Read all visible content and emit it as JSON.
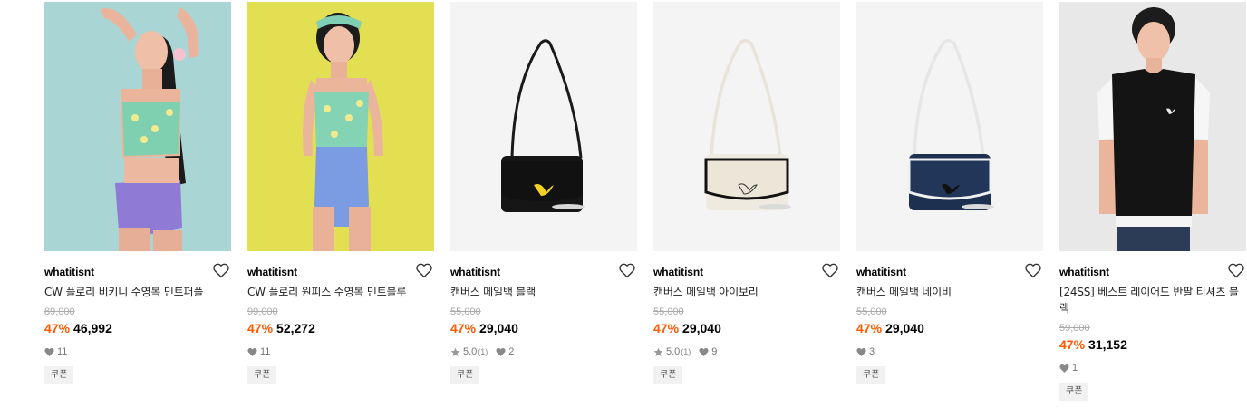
{
  "products": [
    {
      "brand": "whatitisnt",
      "name": "CW 플로리 비키니 수영복 민트퍼플",
      "original_price": "89,000",
      "discount": "47%",
      "price": "46,992",
      "rating": "",
      "rating_count": "",
      "likes": "11",
      "coupon": "쿠폰"
    },
    {
      "brand": "whatitisnt",
      "name": "CW 플로리 원피스 수영복 민트블루",
      "original_price": "99,000",
      "discount": "47%",
      "price": "52,272",
      "rating": "",
      "rating_count": "",
      "likes": "11",
      "coupon": "쿠폰"
    },
    {
      "brand": "whatitisnt",
      "name": "캔버스 메일백 블랙",
      "original_price": "55,000",
      "discount": "47%",
      "price": "29,040",
      "rating": "5.0",
      "rating_count": "(1)",
      "likes": "2",
      "coupon": "쿠폰"
    },
    {
      "brand": "whatitisnt",
      "name": "캔버스 메일백 아이보리",
      "original_price": "55,000",
      "discount": "47%",
      "price": "29,040",
      "rating": "5.0",
      "rating_count": "(1)",
      "likes": "9",
      "coupon": "쿠폰"
    },
    {
      "brand": "whatitisnt",
      "name": "캔버스 메일백 네이비",
      "original_price": "55,000",
      "discount": "47%",
      "price": "29,040",
      "rating": "",
      "rating_count": "",
      "likes": "3",
      "coupon": "쿠폰"
    },
    {
      "brand": "whatitisnt",
      "name": "[24SS] 베스트 레이어드 반팔 티셔츠 블랙",
      "original_price": "59,000",
      "discount": "47%",
      "price": "31,152",
      "rating": "",
      "rating_count": "",
      "likes": "1",
      "coupon": "쿠폰"
    }
  ],
  "colors": {
    "discount": "#ff5a00",
    "original_price": "#aaaaaa",
    "coupon_bg": "#f1f1f1",
    "image_bg_light": "#f4f4f4"
  },
  "icons": {
    "like": "heart-outline-icon",
    "like_count": "heart-filled-icon",
    "rating": "star-icon"
  }
}
